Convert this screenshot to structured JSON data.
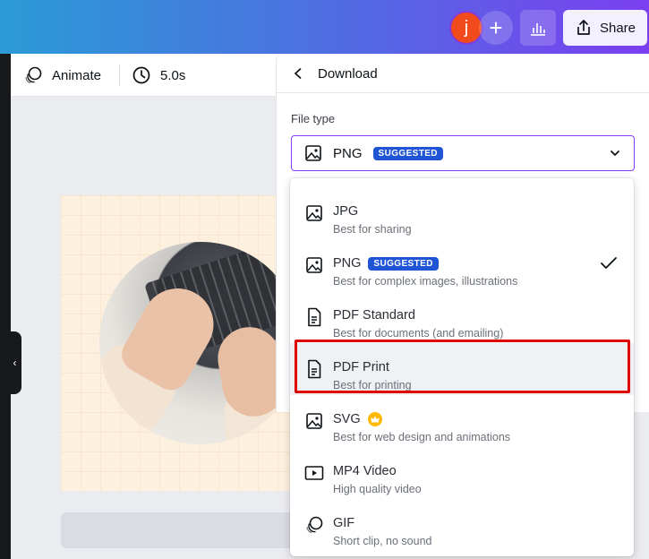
{
  "header": {
    "avatar_initial": "j",
    "plus_label": "+",
    "share_label": "Share",
    "gradient_colors": [
      "#2b9bd6",
      "#4a73e0",
      "#7b3ff0"
    ]
  },
  "toolbar": {
    "animate_label": "Animate",
    "duration_label": "5.0s"
  },
  "sidebar": {
    "collapse_glyph": "‹"
  },
  "download_panel": {
    "title": "Download",
    "file_type_label": "File type",
    "selected_type": "PNG",
    "selected_badge": "SUGGESTED"
  },
  "file_type_options": [
    {
      "name": "JPG",
      "description": "Best for sharing",
      "icon": "image-icon"
    },
    {
      "name": "PNG",
      "description": "Best for complex images, illustrations",
      "icon": "image-icon",
      "badge": "SUGGESTED",
      "selected": true
    },
    {
      "name": "PDF Standard",
      "description": "Best for documents (and emailing)",
      "icon": "document-icon"
    },
    {
      "name": "PDF Print",
      "description": "Best for printing",
      "icon": "document-icon",
      "highlighted": true
    },
    {
      "name": "SVG",
      "description": "Best for web design and animations",
      "icon": "image-icon",
      "premium": true
    },
    {
      "name": "MP4 Video",
      "description": "High quality video",
      "icon": "video-icon"
    },
    {
      "name": "GIF",
      "description": "Short clip, no sound",
      "icon": "gif-icon"
    }
  ],
  "colors": {
    "accent": "#8b3dff",
    "badge": "#1f55d4",
    "highlight_outline": "#e00000",
    "premium_crown": "#ffb800"
  }
}
